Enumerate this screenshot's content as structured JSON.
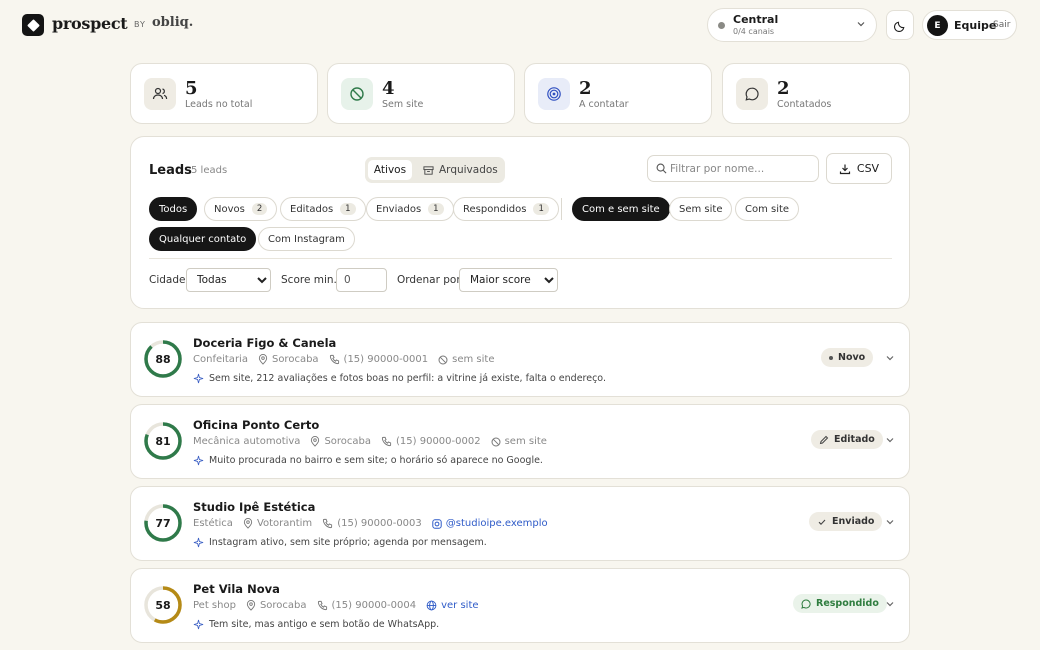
{
  "header": {
    "brand": "prospect",
    "by": "BY",
    "by_brand": "obliq.",
    "workspace": {
      "name": "Central",
      "sub": "0/4 canais"
    },
    "user": {
      "initial": "E",
      "name": "Equipe",
      "logout": "Sair"
    }
  },
  "stats": [
    {
      "value": "5",
      "label": "Leads no total",
      "icon": "users-icon"
    },
    {
      "value": "4",
      "label": "Sem site",
      "icon": "no-site-icon"
    },
    {
      "value": "2",
      "label": "A contatar",
      "icon": "target-icon"
    },
    {
      "value": "2",
      "label": "Contatados",
      "icon": "chat-icon"
    }
  ],
  "panel": {
    "title": "Leads",
    "count": "5 leads",
    "segments": {
      "active": "Ativos",
      "archived": "Arquivados"
    },
    "search_placeholder": "Filtrar por nome...",
    "csv_label": "CSV",
    "status_chips": [
      {
        "label": "Todos",
        "badge": ""
      },
      {
        "label": "Novos",
        "badge": "2"
      },
      {
        "label": "Editados",
        "badge": "1"
      },
      {
        "label": "Enviados",
        "badge": "1"
      },
      {
        "label": "Respondidos",
        "badge": "1"
      }
    ],
    "site_chips": [
      "Com e sem site",
      "Sem site",
      "Com site"
    ],
    "contact_chips": [
      "Qualquer contato",
      "Com Instagram"
    ],
    "filters": {
      "city_label": "Cidade",
      "city_value": "Todas",
      "score_label": "Score min.",
      "score_value": "0",
      "order_label": "Ordenar por",
      "order_value": "Maior score"
    }
  },
  "leads": [
    {
      "score": 88,
      "name": "Doceria Figo & Canela",
      "category": "Confeitaria",
      "city": "Sorocaba",
      "phone": "(15) 90000-0001",
      "site": "sem site",
      "site_type": "none",
      "note": "Sem site, 212 avaliações e fotos boas no perfil: a vitrine já existe, falta o endereço.",
      "status": "Novo",
      "status_icon": "dot-icon",
      "status_color": "#333333"
    },
    {
      "score": 81,
      "name": "Oficina Ponto Certo",
      "category": "Mecânica automotiva",
      "city": "Sorocaba",
      "phone": "(15) 90000-0002",
      "site": "sem site",
      "site_type": "none",
      "note": "Muito procurada no bairro e sem site; o horário só aparece no Google.",
      "status": "Editado",
      "status_icon": "pencil-icon",
      "status_color": "#333333"
    },
    {
      "score": 77,
      "name": "Studio Ipê Estética",
      "category": "Estética",
      "city": "Votorantim",
      "phone": "(15) 90000-0003",
      "site": "@studioipe.exemplo",
      "site_type": "instagram",
      "note": "Instagram ativo, sem site próprio; agenda por mensagem.",
      "status": "Enviado",
      "status_icon": "check-icon",
      "status_color": "#333333"
    },
    {
      "score": 58,
      "name": "Pet Vila Nova",
      "category": "Pet shop",
      "city": "Sorocaba",
      "phone": "(15) 90000-0004",
      "site": "ver site",
      "site_type": "web",
      "note": "Tem site, mas antigo e sem botão de WhatsApp.",
      "status": "Respondido",
      "status_icon": "chat-icon",
      "status_color": "#2f7d3f"
    }
  ],
  "colors": {
    "accent_dark": "#161616",
    "score_high": "#2f7a4a",
    "score_mid": "#b58a16",
    "link": "#2f5bc8"
  }
}
